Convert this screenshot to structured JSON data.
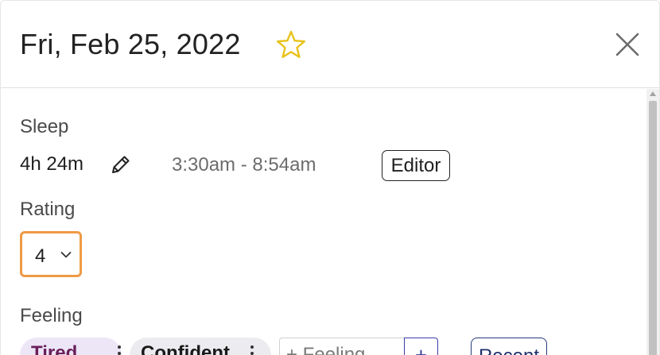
{
  "header": {
    "date_title": "Fri, Feb 25, 2022",
    "star_icon": "star-outline-icon",
    "close_icon": "close-icon"
  },
  "sleep": {
    "label": "Sleep",
    "duration": "4h 24m",
    "time_range": "3:30am - 8:54am",
    "editor_button": "Editor",
    "edit_icon": "pencil-icon"
  },
  "rating": {
    "label": "Rating",
    "selected_value": "4"
  },
  "feeling": {
    "label": "Feeling",
    "chips": [
      {
        "label": "Tired"
      },
      {
        "label": "Confident"
      }
    ],
    "input_placeholder": "+ Feeling",
    "add_button": "+",
    "recent_button": "Recent"
  },
  "colors": {
    "rating_focus": "#ef9a45",
    "star": "#e8c21a",
    "tired_chip_text": "#6a1f5a",
    "primary_blue": "#2e3a9a"
  }
}
